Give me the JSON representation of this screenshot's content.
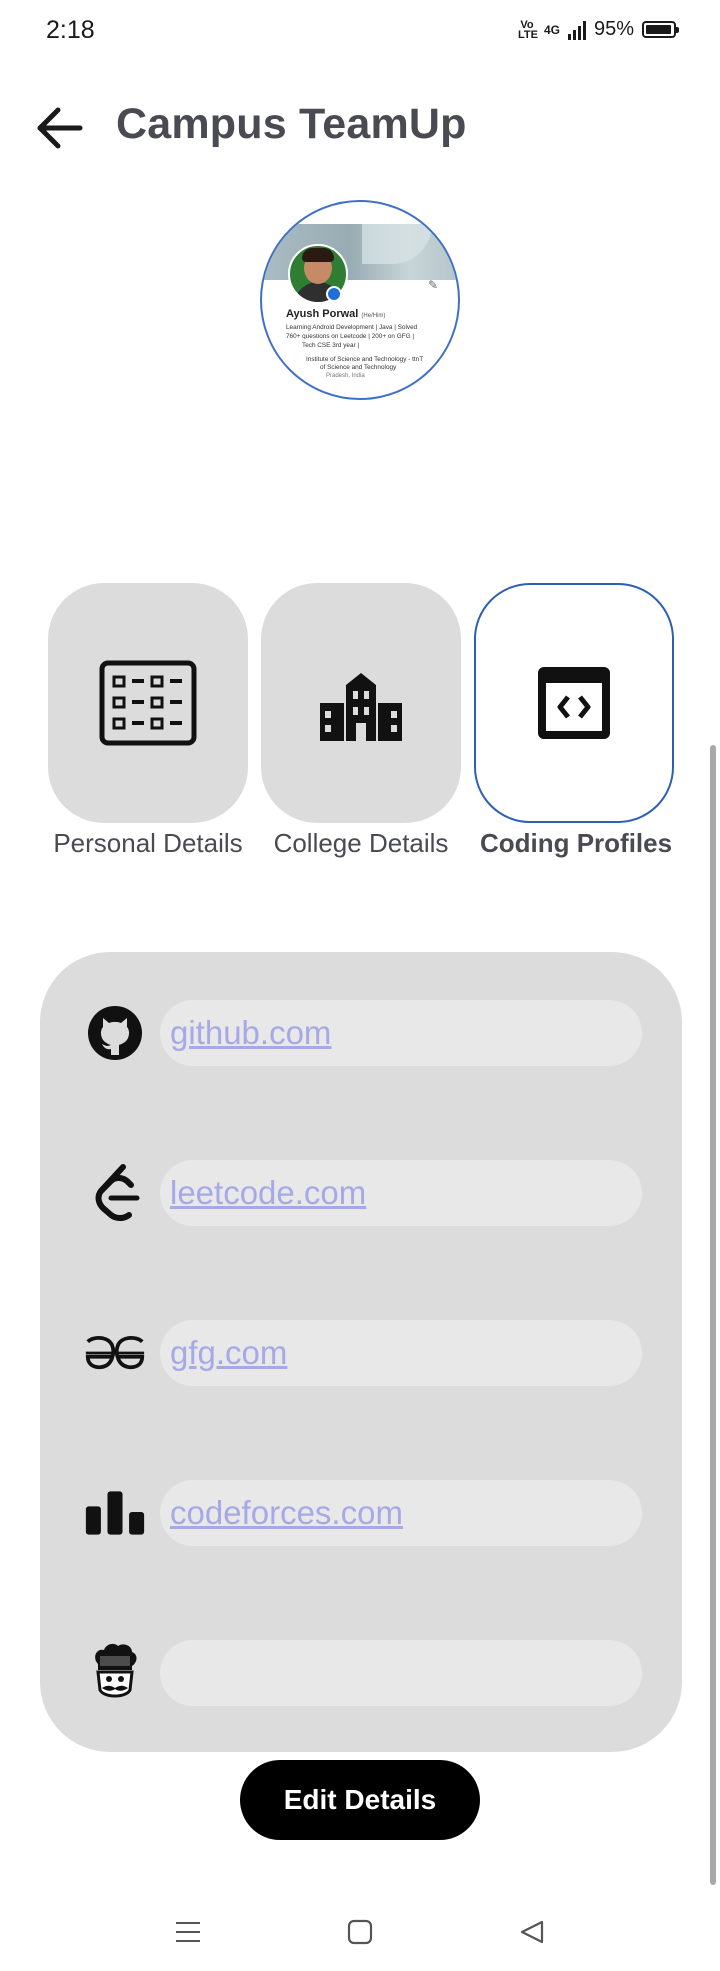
{
  "status_bar": {
    "time": "2:18",
    "volte_label": "Vo\nLTE",
    "network_label": "4G",
    "battery_percent": "95%",
    "battery_level": 0.95
  },
  "header": {
    "title": "Campus TeamUp",
    "back_icon": "arrow-left-icon"
  },
  "profile_image": {
    "name": "Ayush Porwal",
    "pronouns": "(He/Him)",
    "headline_1": "Learning Android Development | Java | Solved",
    "headline_2": "760+ questions on Leetcode | 200+ on GFG |",
    "headline_3": "Tech  CSE 3rd year |",
    "institute_1": "Institute of Science and Technology - ttnT",
    "institute_2": "of Science and Technology",
    "location": "Pradesh, India",
    "border_color": "#3f6fc6"
  },
  "tabs": [
    {
      "label": "Personal Details",
      "icon": "list-details-icon",
      "active": false
    },
    {
      "label": "College Details",
      "icon": "building-icon",
      "active": false
    },
    {
      "label": "Coding Profiles",
      "icon": "code-window-icon",
      "active": true
    }
  ],
  "coding_profiles": [
    {
      "icon": "github-icon",
      "value": "github.com"
    },
    {
      "icon": "leetcode-icon",
      "value": "leetcode.com"
    },
    {
      "icon": "geeksforgeeks-icon",
      "value": "gfg.com"
    },
    {
      "icon": "codeforces-icon",
      "value": "codeforces.com"
    },
    {
      "icon": "codechef-icon",
      "value": ""
    }
  ],
  "edit_button": {
    "label": "Edit Details"
  },
  "navigation_bar": {
    "menu_icon": "menu-icon",
    "home_icon": "home-square-icon",
    "back_icon": "back-triangle-icon"
  },
  "colors": {
    "accent_border": "#2f5fb5",
    "link": "#a6a9e8",
    "card_bg": "#dcdcdc",
    "button_bg": "#000000"
  }
}
